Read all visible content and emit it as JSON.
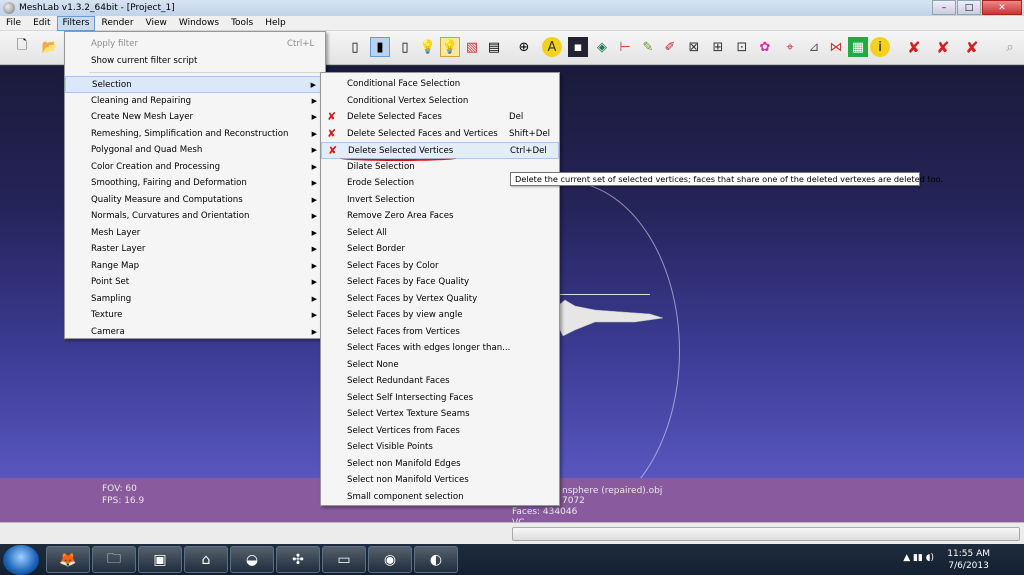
{
  "window": {
    "title": "MeshLab v1.3.2_64bit - [Project_1]",
    "min": "–",
    "max": "□",
    "close": "✕"
  },
  "menubar": [
    "File",
    "Edit",
    "Filters",
    "Render",
    "View",
    "Windows",
    "Tools",
    "Help"
  ],
  "filters_menu": {
    "apply_filter": "Apply filter",
    "apply_filter_shortcut": "Ctrl+L",
    "show_script": "Show current filter script",
    "items": [
      "Selection",
      "Cleaning and Repairing",
      "Create New Mesh Layer",
      "Remeshing, Simplification and Reconstruction",
      "Polygonal and Quad Mesh",
      "Color Creation and Processing",
      "Smoothing, Fairing and Deformation",
      "Quality Measure and Computations",
      "Normals, Curvatures and Orientation",
      "Mesh Layer",
      "Raster Layer",
      "Range Map",
      "Point Set",
      "Sampling",
      "Texture",
      "Camera"
    ],
    "arrow": "▶"
  },
  "selection_menu": {
    "items": [
      {
        "label": "Conditional Face Selection",
        "shortcut": ""
      },
      {
        "label": "Conditional Vertex Selection",
        "shortcut": ""
      },
      {
        "label": "Delete Selected Faces",
        "shortcut": "Del"
      },
      {
        "label": "Delete Selected Faces and Vertices",
        "shortcut": "Shift+Del"
      },
      {
        "label": "Delete Selected Vertices",
        "shortcut": "Ctrl+Del"
      },
      {
        "label": "Dilate Selection",
        "shortcut": ""
      },
      {
        "label": "Erode Selection",
        "shortcut": ""
      },
      {
        "label": "Invert Selection",
        "shortcut": ""
      },
      {
        "label": "Remove Zero Area Faces",
        "shortcut": ""
      },
      {
        "label": "Select All",
        "shortcut": ""
      },
      {
        "label": "Select Border",
        "shortcut": ""
      },
      {
        "label": "Select Faces by Color",
        "shortcut": ""
      },
      {
        "label": "Select Faces by Face Quality",
        "shortcut": ""
      },
      {
        "label": "Select Faces by Vertex Quality",
        "shortcut": ""
      },
      {
        "label": "Select Faces by view angle",
        "shortcut": ""
      },
      {
        "label": "Select Faces from Vertices",
        "shortcut": ""
      },
      {
        "label": "Select Faces with edges longer than...",
        "shortcut": ""
      },
      {
        "label": "Select None",
        "shortcut": ""
      },
      {
        "label": "Select Redundant Faces",
        "shortcut": ""
      },
      {
        "label": "Select Self Intersecting Faces",
        "shortcut": ""
      },
      {
        "label": "Select Vertex Texture Seams",
        "shortcut": ""
      },
      {
        "label": "Select Vertices from Faces",
        "shortcut": ""
      },
      {
        "label": "Select Visible Points",
        "shortcut": ""
      },
      {
        "label": "Select non Manifold Edges",
        "shortcut": ""
      },
      {
        "label": "Select non Manifold Vertices",
        "shortcut": ""
      },
      {
        "label": "Small component selection",
        "shortcut": ""
      }
    ]
  },
  "tooltip": "Delete the current set of selected vertices; faces that share one of the deleted vertexes are deleted too.",
  "viewport": {
    "fov": "FOV: 60",
    "fps": "FPS:    16.9",
    "mesh_name": "nsphere (repaired).obj",
    "verts": "7072",
    "faces": "Faces: 434046",
    "vc": "VC"
  },
  "taskbar": {
    "time": "11:55 AM",
    "date": "7/6/2013"
  }
}
